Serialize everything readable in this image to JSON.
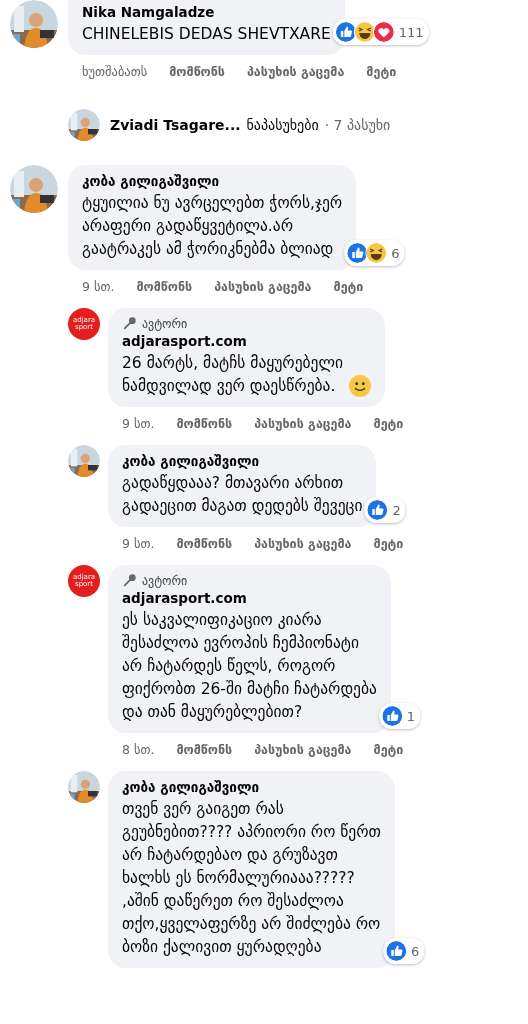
{
  "comments": [
    {
      "kind": "top",
      "name": "Nika Namgaladze",
      "text": "CHINELEBIS DEDAS SHEVTXARE",
      "reactions": {
        "icons": [
          {
            "kind": "like"
          },
          {
            "kind": "haha"
          },
          {
            "kind": "love"
          }
        ],
        "count": "111"
      },
      "time": "ხუთშაბათს",
      "actions": [
        "მომწონს",
        "პასუხის გაცემა",
        "მეტი"
      ]
    },
    {
      "kind": "summary",
      "name": "Zviadi Tsagare...",
      "label": "ნაპასუხები",
      "count": "· 7 პასუხი"
    },
    {
      "kind": "top",
      "name": "კობა გილიგაშვილი",
      "text": "ტყუილია ნუ ავრცელებთ ჭორს,ჯერ\nარაფერი გადაწყვეტილა.არ\nგაატრაკეს ამ ჭორიკნებმა ბლიად",
      "reactions": {
        "icons": [
          {
            "kind": "like"
          },
          {
            "kind": "haha"
          }
        ],
        "count": "6"
      },
      "time": "9 სთ.",
      "actions": [
        "მომწონს",
        "პასუხის გაცემა",
        "მეტი"
      ]
    },
    {
      "kind": "reply",
      "avatar": {
        "kind": "logo",
        "lines": [
          "adjara",
          "sport"
        ]
      },
      "badge": "ავტორი",
      "name": "adjarasport.com",
      "text": "26 მარტს, მატჩს მაყურებელი\nნამდვილად ვერ დაესწრება.",
      "emoji": {
        "kind": "smile"
      },
      "time": "9 სთ.",
      "actions": [
        "მომწონს",
        "პასუხის გაცემა",
        "მეტი"
      ]
    },
    {
      "kind": "reply",
      "name": "კობა გილიგაშვილი",
      "text": "გადაწყდააა? მთავარი არხით\nგადაეცით მაგათ დედებს შევეცი",
      "reactions": {
        "icons": [
          {
            "kind": "like"
          }
        ],
        "count": "2"
      },
      "time": "9 სთ.",
      "actions": [
        "მომწონს",
        "პასუხის გაცემა",
        "მეტი"
      ]
    },
    {
      "kind": "reply",
      "avatar": {
        "kind": "logo",
        "lines": [
          "adjara",
          "sport"
        ]
      },
      "badge": "ავტორი",
      "name": "adjarasport.com",
      "text": "ეს საკვალიფიკაციო კიარა\nშესაძლოა ევროპის ჩემპიონატი\nარ ჩატარდეს წელს, როგორ\nფიქრობთ 26-ში მატჩი ჩატარდება\nდა თან მაყურებლებით?",
      "reactions": {
        "icons": [
          {
            "kind": "like"
          }
        ],
        "count": "1"
      },
      "time": "8 სთ.",
      "actions": [
        "მომწონს",
        "პასუხის გაცემა",
        "მეტი"
      ]
    },
    {
      "kind": "reply",
      "name": "კობა გილიგაშვილი",
      "text": "თვენ ვერ გაიგეთ რას\nგეუბნებით???? აპრიორი რო წერთ\nარ ჩატარდებაო და გრუზავთ\nხალხს ეს ნორმალურიააა?????\n,აშინ დაწერეთ რო შესაძლოა\nთქო,ყველაფერზე არ შიძლება რო\nბოზი ქალივით ყურადღება",
      "reactions": {
        "icons": [
          {
            "kind": "like"
          }
        ],
        "count": "6"
      }
    }
  ]
}
